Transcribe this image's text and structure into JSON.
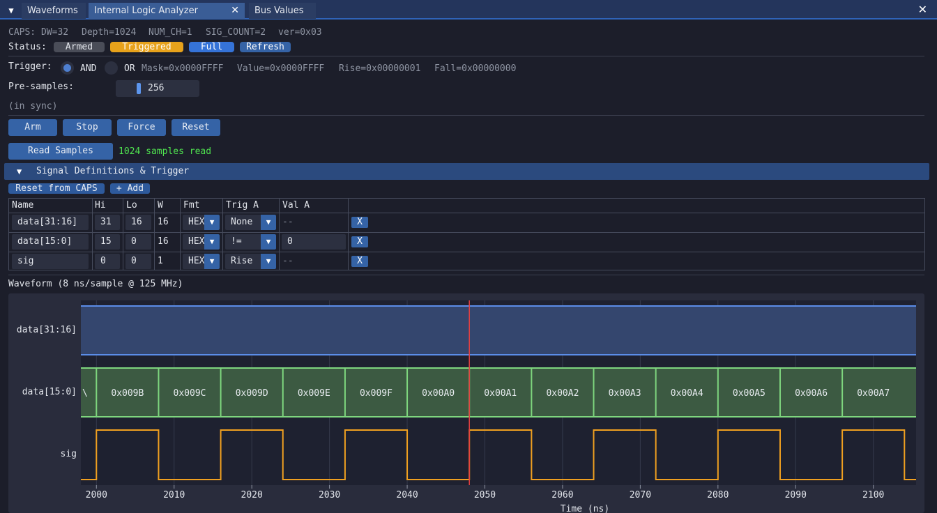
{
  "tabs": [
    {
      "label": "Waveforms"
    },
    {
      "label": "Internal Logic Analyzer"
    },
    {
      "label": "Bus Values"
    }
  ],
  "icons": {
    "menu": "triangle-down-icon",
    "tab_close": "close-icon",
    "window_close": "close-icon"
  },
  "caps": {
    "dw": "CAPS: DW=32",
    "depth": "Depth=1024",
    "num_ch": "NUM_CH=1",
    "sig_count": "SIG_COUNT=2",
    "ver": "ver=0x03"
  },
  "status": {
    "label": "Status:",
    "armed": "Armed",
    "triggered": "Triggered",
    "full": "Full",
    "refresh": "Refresh",
    "colors": {
      "armed": "#4a4d58",
      "triggered": "#e7a21b",
      "full": "#3573d8",
      "refresh": "#3563a6"
    }
  },
  "trigger": {
    "label": "Trigger:",
    "and_label": "AND",
    "or_label": "OR",
    "selected": "AND",
    "mask": "Mask=0x0000FFFF",
    "value": "Value=0x0000FFFF",
    "rise": "Rise=0x00000001",
    "fall": "Fall=0x00000000"
  },
  "presamples": {
    "label": "Pre-samples:",
    "value": "256"
  },
  "sync_status": "(in sync)",
  "controls": {
    "arm": "Arm",
    "stop": "Stop",
    "force": "Force",
    "reset": "Reset"
  },
  "read": {
    "button": "Read Samples",
    "result": "1024 samples read",
    "result_color": "#4fe24f"
  },
  "signal_section": {
    "title": "Signal Definitions & Trigger",
    "reset_caps": "Reset from CAPS",
    "add": "+ Add"
  },
  "table": {
    "headers": {
      "name": "Name",
      "hi": "Hi",
      "lo": "Lo",
      "w": "W",
      "fmt": "Fmt",
      "trig": "Trig A",
      "val": "Val A"
    },
    "rows": [
      {
        "name": "data[31:16]",
        "hi": "31",
        "lo": "16",
        "w": "16",
        "fmt": "HEX",
        "trig": "None",
        "val": "--",
        "del": "X"
      },
      {
        "name": "data[15:0]",
        "hi": "15",
        "lo": "0",
        "w": "16",
        "fmt": "HEX",
        "trig": "!=",
        "val": "0",
        "del": "X"
      },
      {
        "name": "sig",
        "hi": "0",
        "lo": "0",
        "w": "1",
        "fmt": "HEX",
        "trig": "Rise",
        "val": "--",
        "del": "X"
      }
    ]
  },
  "waveform": {
    "title": "Waveform  (8 ns/sample @ 125 MHz)",
    "signals": [
      "data[31:16]",
      "data[15:0]",
      "sig"
    ],
    "xlabel": "Time (ns)",
    "x_range": [
      1998,
      2105.5
    ],
    "ticks": [
      2000,
      2010,
      2020,
      2030,
      2040,
      2050,
      2060,
      2070,
      2080,
      2090,
      2100
    ],
    "trigger_time": 2048,
    "bus_values": [
      {
        "t": 2000,
        "label": "0x009B"
      },
      {
        "t": 2008,
        "label": "0x009C"
      },
      {
        "t": 2016,
        "label": "0x009D"
      },
      {
        "t": 2024,
        "label": "0x009E"
      },
      {
        "t": 2032,
        "label": "0x009F"
      },
      {
        "t": 2040,
        "label": "0x00A0"
      },
      {
        "t": 2048,
        "label": "0x00A1"
      },
      {
        "t": 2056,
        "label": "0x00A2"
      },
      {
        "t": 2064,
        "label": "0x00A3"
      },
      {
        "t": 2072,
        "label": "0x00A4"
      },
      {
        "t": 2080,
        "label": "0x00A5"
      },
      {
        "t": 2088,
        "label": "0x00A6"
      },
      {
        "t": 2096,
        "label": "0x00A7"
      }
    ],
    "sig_edges": [
      {
        "t": 2000,
        "level": 1
      },
      {
        "t": 2008,
        "level": 0
      },
      {
        "t": 2016,
        "level": 1
      },
      {
        "t": 2024,
        "level": 0
      },
      {
        "t": 2032,
        "level": 1
      },
      {
        "t": 2040,
        "level": 0
      },
      {
        "t": 2048,
        "level": 1
      },
      {
        "t": 2056,
        "level": 0
      },
      {
        "t": 2064,
        "level": 1
      },
      {
        "t": 2072,
        "level": 0
      },
      {
        "t": 2080,
        "level": 1
      },
      {
        "t": 2088,
        "level": 0
      },
      {
        "t": 2096,
        "level": 1
      },
      {
        "t": 2104,
        "level": 0
      }
    ],
    "sig_initial_level": 0,
    "colors": {
      "upper_bus": "#5b8de8",
      "lower_bus": "#7ed67e",
      "sig": "#f0a020",
      "trigger": "#e84040"
    }
  }
}
